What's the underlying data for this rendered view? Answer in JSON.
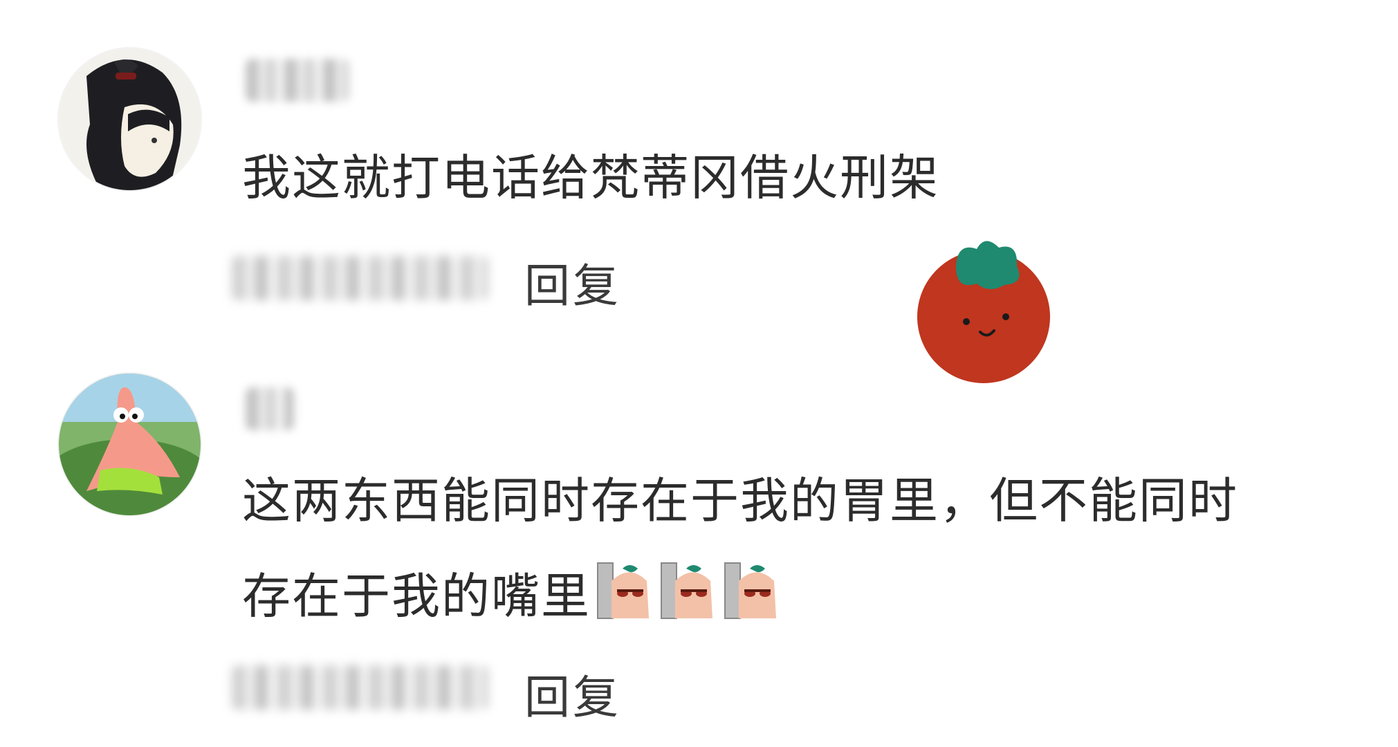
{
  "comments": [
    {
      "text": "我这就打电话给梵蒂冈借火刑架",
      "reply_label": "回复",
      "avatar": "anime-girl-avatar"
    },
    {
      "text_line1": "这两东西能同时存在于我的胃里，但不能同时",
      "text_line2": "存在于我的嘴里",
      "reply_label": "回复",
      "avatar": "patrick-star-avatar",
      "emoji": [
        "peeking-sticker-emoji",
        "peeking-sticker-emoji",
        "peeking-sticker-emoji"
      ]
    }
  ],
  "decoration": "tomato-sticker",
  "colors": {
    "text": "#2c2c2c",
    "tomato": "#c0361f",
    "tomato_leaf": "#1f8a70"
  }
}
